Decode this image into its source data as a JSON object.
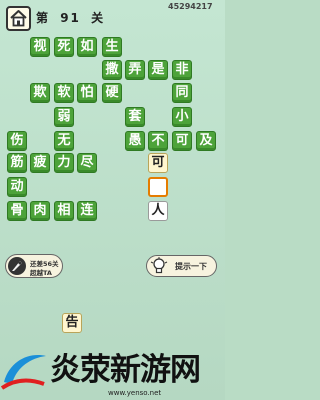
{
  "header": {
    "level_prefix": "第",
    "level_number": "91",
    "level_suffix": "关",
    "player_id": "45294217"
  },
  "board": {
    "tiles": [
      {
        "ch": "视",
        "r": 0,
        "c": 1,
        "kind": "filled"
      },
      {
        "ch": "死",
        "r": 0,
        "c": 2,
        "kind": "filled"
      },
      {
        "ch": "如",
        "r": 0,
        "c": 3,
        "kind": "filled"
      },
      {
        "ch": "生",
        "r": 0,
        "c": 4,
        "kind": "filled"
      },
      {
        "ch": "撒",
        "r": 1,
        "c": 4,
        "kind": "filled"
      },
      {
        "ch": "弄",
        "r": 1,
        "c": 5,
        "kind": "filled"
      },
      {
        "ch": "是",
        "r": 1,
        "c": 6,
        "kind": "filled"
      },
      {
        "ch": "非",
        "r": 1,
        "c": 7,
        "kind": "filled"
      },
      {
        "ch": "欺",
        "r": 2,
        "c": 1,
        "kind": "filled"
      },
      {
        "ch": "软",
        "r": 2,
        "c": 2,
        "kind": "filled"
      },
      {
        "ch": "怕",
        "r": 2,
        "c": 3,
        "kind": "filled"
      },
      {
        "ch": "硬",
        "r": 2,
        "c": 4,
        "kind": "filled"
      },
      {
        "ch": "同",
        "r": 2,
        "c": 7,
        "kind": "filled"
      },
      {
        "ch": "弱",
        "r": 3,
        "c": 2,
        "kind": "filled"
      },
      {
        "ch": "套",
        "r": 3,
        "c": 5,
        "kind": "filled"
      },
      {
        "ch": "小",
        "r": 3,
        "c": 7,
        "kind": "filled"
      },
      {
        "ch": "伤",
        "r": 4,
        "c": 0,
        "kind": "filled"
      },
      {
        "ch": "无",
        "r": 4,
        "c": 2,
        "kind": "filled"
      },
      {
        "ch": "愚",
        "r": 4,
        "c": 5,
        "kind": "filled"
      },
      {
        "ch": "不",
        "r": 4,
        "c": 6,
        "kind": "filled"
      },
      {
        "ch": "可",
        "r": 4,
        "c": 7,
        "kind": "filled"
      },
      {
        "ch": "及",
        "r": 4,
        "c": 8,
        "kind": "filled"
      },
      {
        "ch": "筋",
        "r": 5,
        "c": 0,
        "kind": "filled"
      },
      {
        "ch": "疲",
        "r": 5,
        "c": 1,
        "kind": "filled"
      },
      {
        "ch": "力",
        "r": 5,
        "c": 2,
        "kind": "filled"
      },
      {
        "ch": "尽",
        "r": 5,
        "c": 3,
        "kind": "filled"
      },
      {
        "ch": "可",
        "r": 5,
        "c": 6,
        "kind": "candidate"
      },
      {
        "ch": "动",
        "r": 6,
        "c": 0,
        "kind": "filled"
      },
      {
        "ch": "",
        "r": 6,
        "c": 6,
        "kind": "selected"
      },
      {
        "ch": "骨",
        "r": 7,
        "c": 0,
        "kind": "filled"
      },
      {
        "ch": "肉",
        "r": 7,
        "c": 1,
        "kind": "filled"
      },
      {
        "ch": "相",
        "r": 7,
        "c": 2,
        "kind": "filled"
      },
      {
        "ch": "连",
        "r": 7,
        "c": 3,
        "kind": "filled"
      },
      {
        "ch": "人",
        "r": 7,
        "c": 6,
        "kind": "given"
      }
    ]
  },
  "skip_button": {
    "line1": "还差56关",
    "line2": "超越TA",
    "icon": "rocket-icon"
  },
  "hint_button": {
    "label": "提示一下",
    "icon": "lightbulb-icon"
  },
  "answer_choices": [
    {
      "ch": "告"
    }
  ],
  "watermark": {
    "text": "炎荥新游网",
    "url": "www.yenso.net"
  },
  "colors": {
    "background": "#c4e6d2",
    "tile_green": "#4da33a",
    "candidate_tile": "#fff6cf",
    "selected_border": "#e57c00"
  }
}
